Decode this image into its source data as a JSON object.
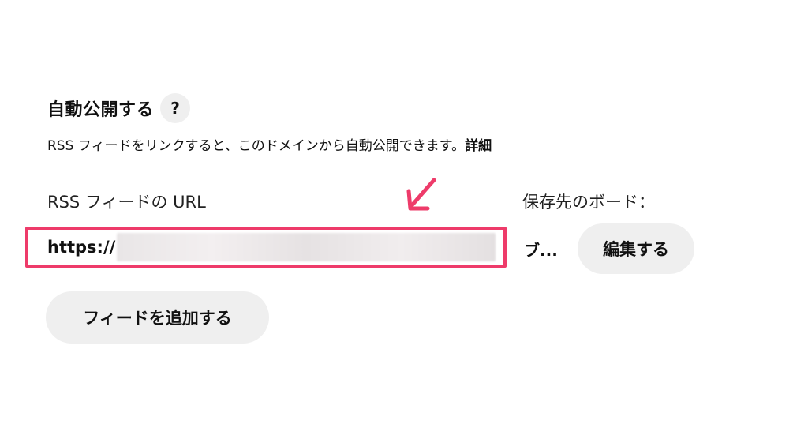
{
  "autopublish": {
    "title": "自動公開する",
    "help_icon_glyph": "?",
    "description": "RSS フィードをリンクすると、このドメインから自動公開できます。",
    "detail_link": "詳細"
  },
  "feed": {
    "url_label": "RSS フィードの URL",
    "url_value": "https://",
    "board_label": "保存先のボード：",
    "board_value": "ブ...",
    "edit_button": "編集する",
    "add_feed_button": "フィードを追加する"
  },
  "annotation": {
    "highlight_color": "#ee3b6a",
    "arrow_icon": "arrow-down-left-icon"
  }
}
